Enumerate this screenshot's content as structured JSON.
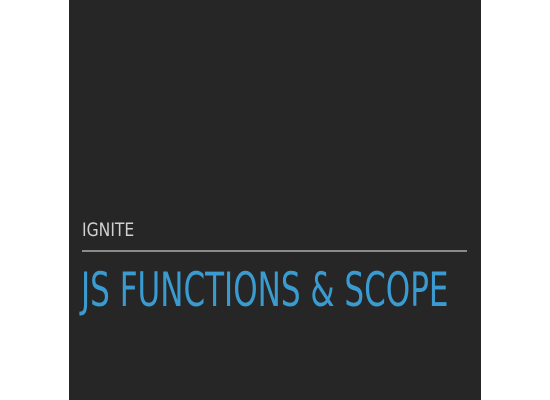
{
  "slide": {
    "eyebrow": "IGNITE",
    "title": "JS FUNCTIONS & SCOPE",
    "colors": {
      "background": "#262626",
      "title": "#3a9bd1",
      "eyebrow": "#d0d0d0",
      "rule": "#8a8a8a"
    }
  }
}
